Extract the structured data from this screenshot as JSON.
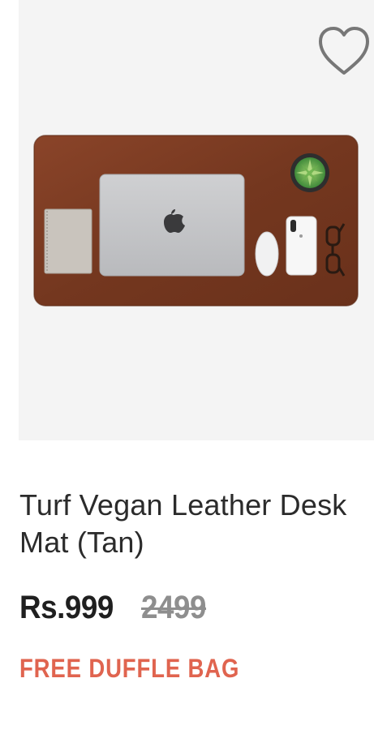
{
  "product": {
    "title": "Turf Vegan Leather Desk Mat (Tan)",
    "price": "Rs.999",
    "mrp": "2499",
    "offer": "FREE DUFFLE BAG",
    "image_icon": "desk-mat-product-photo",
    "wishlist_icon": "heart-outline-icon"
  },
  "colors": {
    "image_background": "#f4f4f4",
    "mat": "#7a3a22",
    "price_text": "#1f1f1f",
    "mrp_text": "#8e8e8e",
    "offer_text": "#e0644f"
  }
}
